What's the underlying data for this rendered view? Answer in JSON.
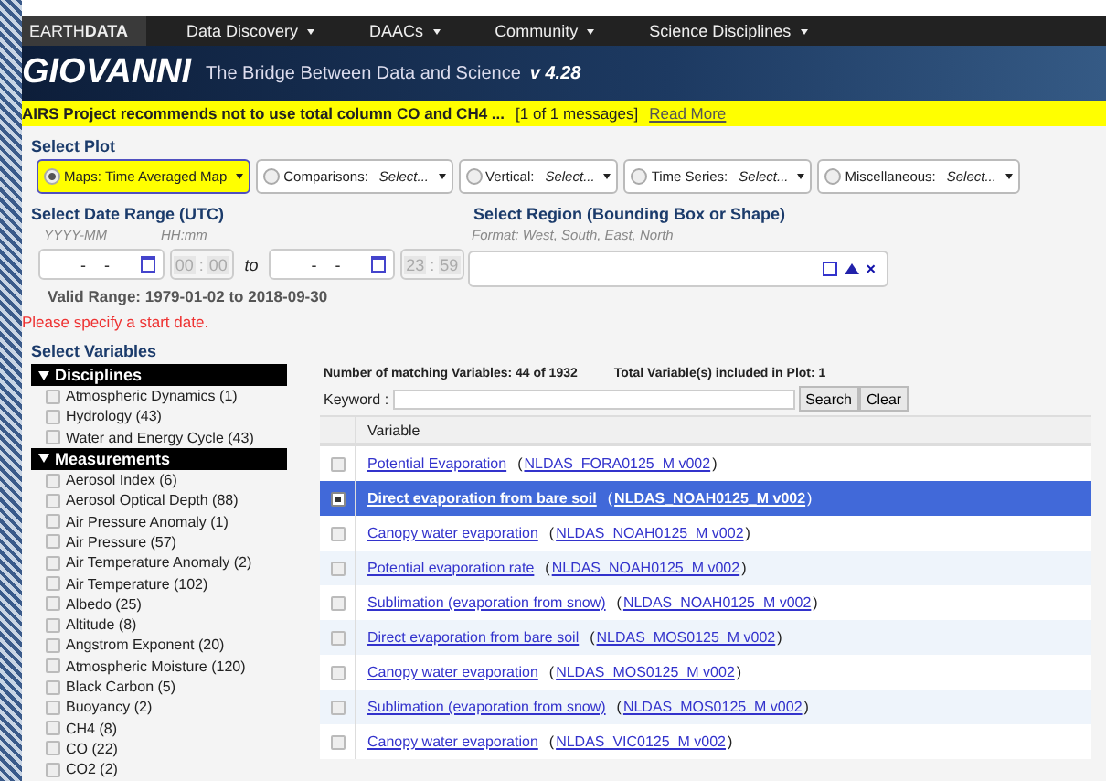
{
  "nav": {
    "brand": "EARTH**DATA**",
    "items": [
      {
        "label": "Data Discovery"
      },
      {
        "label": "DAACs"
      },
      {
        "label": "Community"
      },
      {
        "label": "Science Disciplines"
      }
    ]
  },
  "banner": {
    "logo": "GIOVANNI",
    "tagline": "The Bridge Between Data and Science",
    "version": "v 4.28"
  },
  "message": {
    "text": "AIRS Project recommends not to use total column CO and CH4 ...",
    "count": "[1 of 1 messages]",
    "link": "Read More"
  },
  "select_plot": {
    "title": "Select Plot",
    "options": [
      {
        "label": "Maps:",
        "value": "Time Averaged Map",
        "selected": true
      },
      {
        "label": "Comparisons:",
        "value": "Select...",
        "selected": false
      },
      {
        "label": "Vertical:",
        "value": "Select...",
        "selected": false
      },
      {
        "label": "Time Series:",
        "value": "Select...",
        "selected": false
      },
      {
        "label": "Miscellaneous:",
        "value": "Select...",
        "selected": false
      }
    ]
  },
  "date_range": {
    "title": "Select Date Range (UTC)",
    "date_hint": "YYYY-MM",
    "time_hint": "HH:mm",
    "start": {
      "date": "-    -",
      "hour": "00",
      "minute": "00"
    },
    "time_sep": ":",
    "to": "to",
    "end": {
      "date": "-    -",
      "hour": "23",
      "minute": "59"
    },
    "valid_range": "Valid Range: 1979-01-02 to 2018-09-30",
    "error": "Please specify a start date."
  },
  "region": {
    "title": "Select Region (Bounding Box or Shape)",
    "hint": "Format: West, South, East, North",
    "clear": "×"
  },
  "variables": {
    "title": "Select Variables",
    "facets": [
      {
        "title": "Disciplines",
        "expanded": true,
        "items": [
          {
            "label": "Atmospheric Dynamics (1)",
            "checked": false
          },
          {
            "label": "Hydrology (43)",
            "checked": false
          },
          {
            "label": "Water and Energy Cycle (43)",
            "checked": false
          }
        ]
      },
      {
        "title": "Measurements",
        "expanded": true,
        "items": [
          {
            "label": "Aerosol Index (6)",
            "checked": false
          },
          {
            "label": "Aerosol Optical Depth (88)",
            "checked": false
          },
          {
            "label": "Air Pressure Anomaly (1)",
            "checked": false
          },
          {
            "label": "Air Pressure (57)",
            "checked": false
          },
          {
            "label": "Air Temperature Anomaly (2)",
            "checked": false
          },
          {
            "label": "Air Temperature (102)",
            "checked": false
          },
          {
            "label": "Albedo (25)",
            "checked": false
          },
          {
            "label": "Altitude (8)",
            "checked": false
          },
          {
            "label": "Angstrom Exponent (20)",
            "checked": false
          },
          {
            "label": "Atmospheric Moisture (120)",
            "checked": false
          },
          {
            "label": "Black Carbon (5)",
            "checked": false
          },
          {
            "label": "Buoyancy (2)",
            "checked": false
          },
          {
            "label": "CH4 (8)",
            "checked": false
          },
          {
            "label": "CO (22)",
            "checked": false
          },
          {
            "label": "CO2 (2)",
            "checked": false
          }
        ]
      }
    ],
    "matching": "Number of matching Variables: 44 of 1932",
    "total": "Total Variable(s) included in Plot: 1",
    "keyword_label": "Keyword :",
    "search": "Search",
    "clear": "Clear",
    "paren_open": "(",
    "paren_close": ")",
    "columns": [
      "Variable"
    ],
    "rows": [
      {
        "name": "Potential Evaporation",
        "product": "NLDAS_FORA0125_M v002",
        "checked": false,
        "selected": false
      },
      {
        "name": "Direct evaporation from bare soil",
        "product": "NLDAS_NOAH0125_M v002",
        "checked": true,
        "selected": true
      },
      {
        "name": "Canopy water evaporation",
        "product": "NLDAS_NOAH0125_M v002",
        "checked": false,
        "selected": false
      },
      {
        "name": "Potential evaporation rate",
        "product": "NLDAS_NOAH0125_M v002",
        "checked": false,
        "selected": false
      },
      {
        "name": "Sublimation (evaporation from snow)",
        "product": "NLDAS_NOAH0125_M v002",
        "checked": false,
        "selected": false
      },
      {
        "name": "Direct evaporation from bare soil",
        "product": "NLDAS_MOS0125_M v002",
        "checked": false,
        "selected": false
      },
      {
        "name": "Canopy water evaporation",
        "product": "NLDAS_MOS0125_M v002",
        "checked": false,
        "selected": false
      },
      {
        "name": "Sublimation (evaporation from snow)",
        "product": "NLDAS_MOS0125_M v002",
        "checked": false,
        "selected": false
      },
      {
        "name": "Canopy water evaporation",
        "product": "NLDAS_VIC0125_M v002",
        "checked": false,
        "selected": false
      }
    ]
  }
}
